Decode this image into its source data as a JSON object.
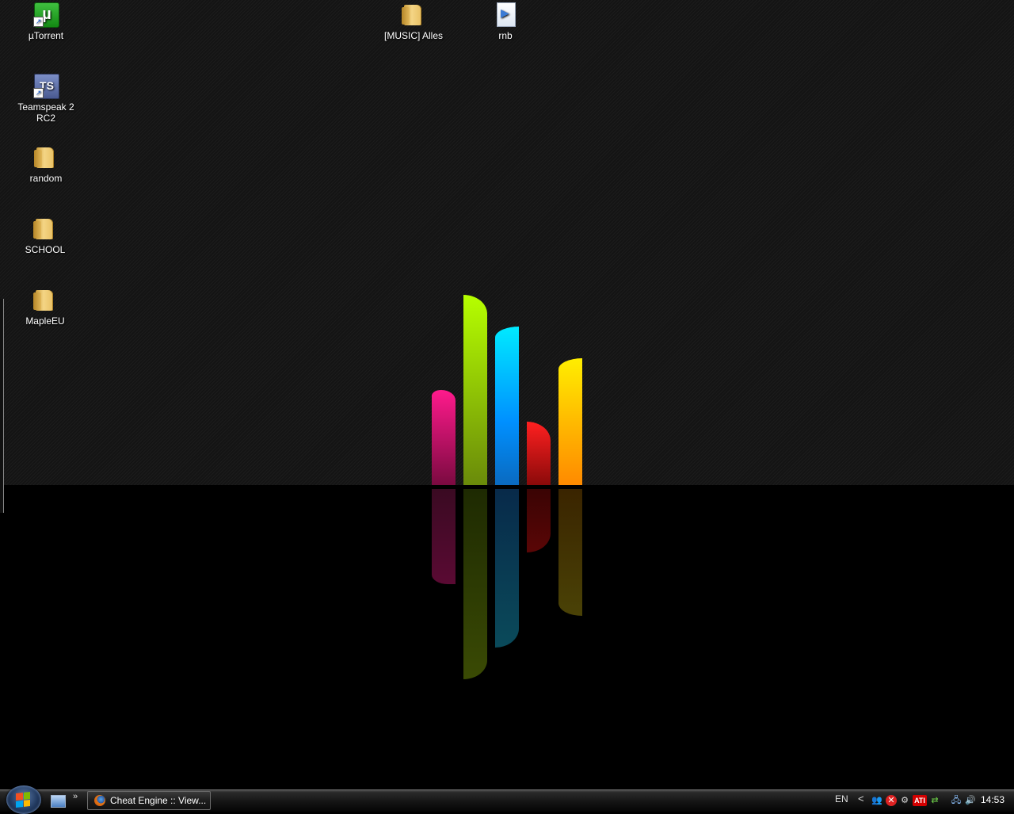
{
  "desktop": {
    "icons": [
      {
        "label": "µTorrent",
        "icon": "utorrent-icon"
      },
      {
        "label": "Teamspeak 2 RC2",
        "icon": "teamspeak-icon"
      },
      {
        "label": "random",
        "icon": "folder-icon"
      },
      {
        "label": "SCHOOL",
        "icon": "folder-icon"
      },
      {
        "label": "MapleEU",
        "icon": "folder-icon"
      },
      {
        "label": "[MUSIC] Alles",
        "icon": "folder-icon"
      },
      {
        "label": "rnb",
        "icon": "media-playlist-icon"
      }
    ]
  },
  "wallpaper": {
    "bar_colors": [
      "#ff1a8c",
      "#b6ff00",
      "#00c8ff",
      "#ff1010",
      "#ffd400"
    ]
  },
  "taskbar": {
    "quick_launch_more": "»",
    "task_button_label": "Cheat Engine :: View...",
    "language": "EN",
    "tray_expand": "<",
    "tray_ati": "ATI",
    "clock": "14:53"
  }
}
